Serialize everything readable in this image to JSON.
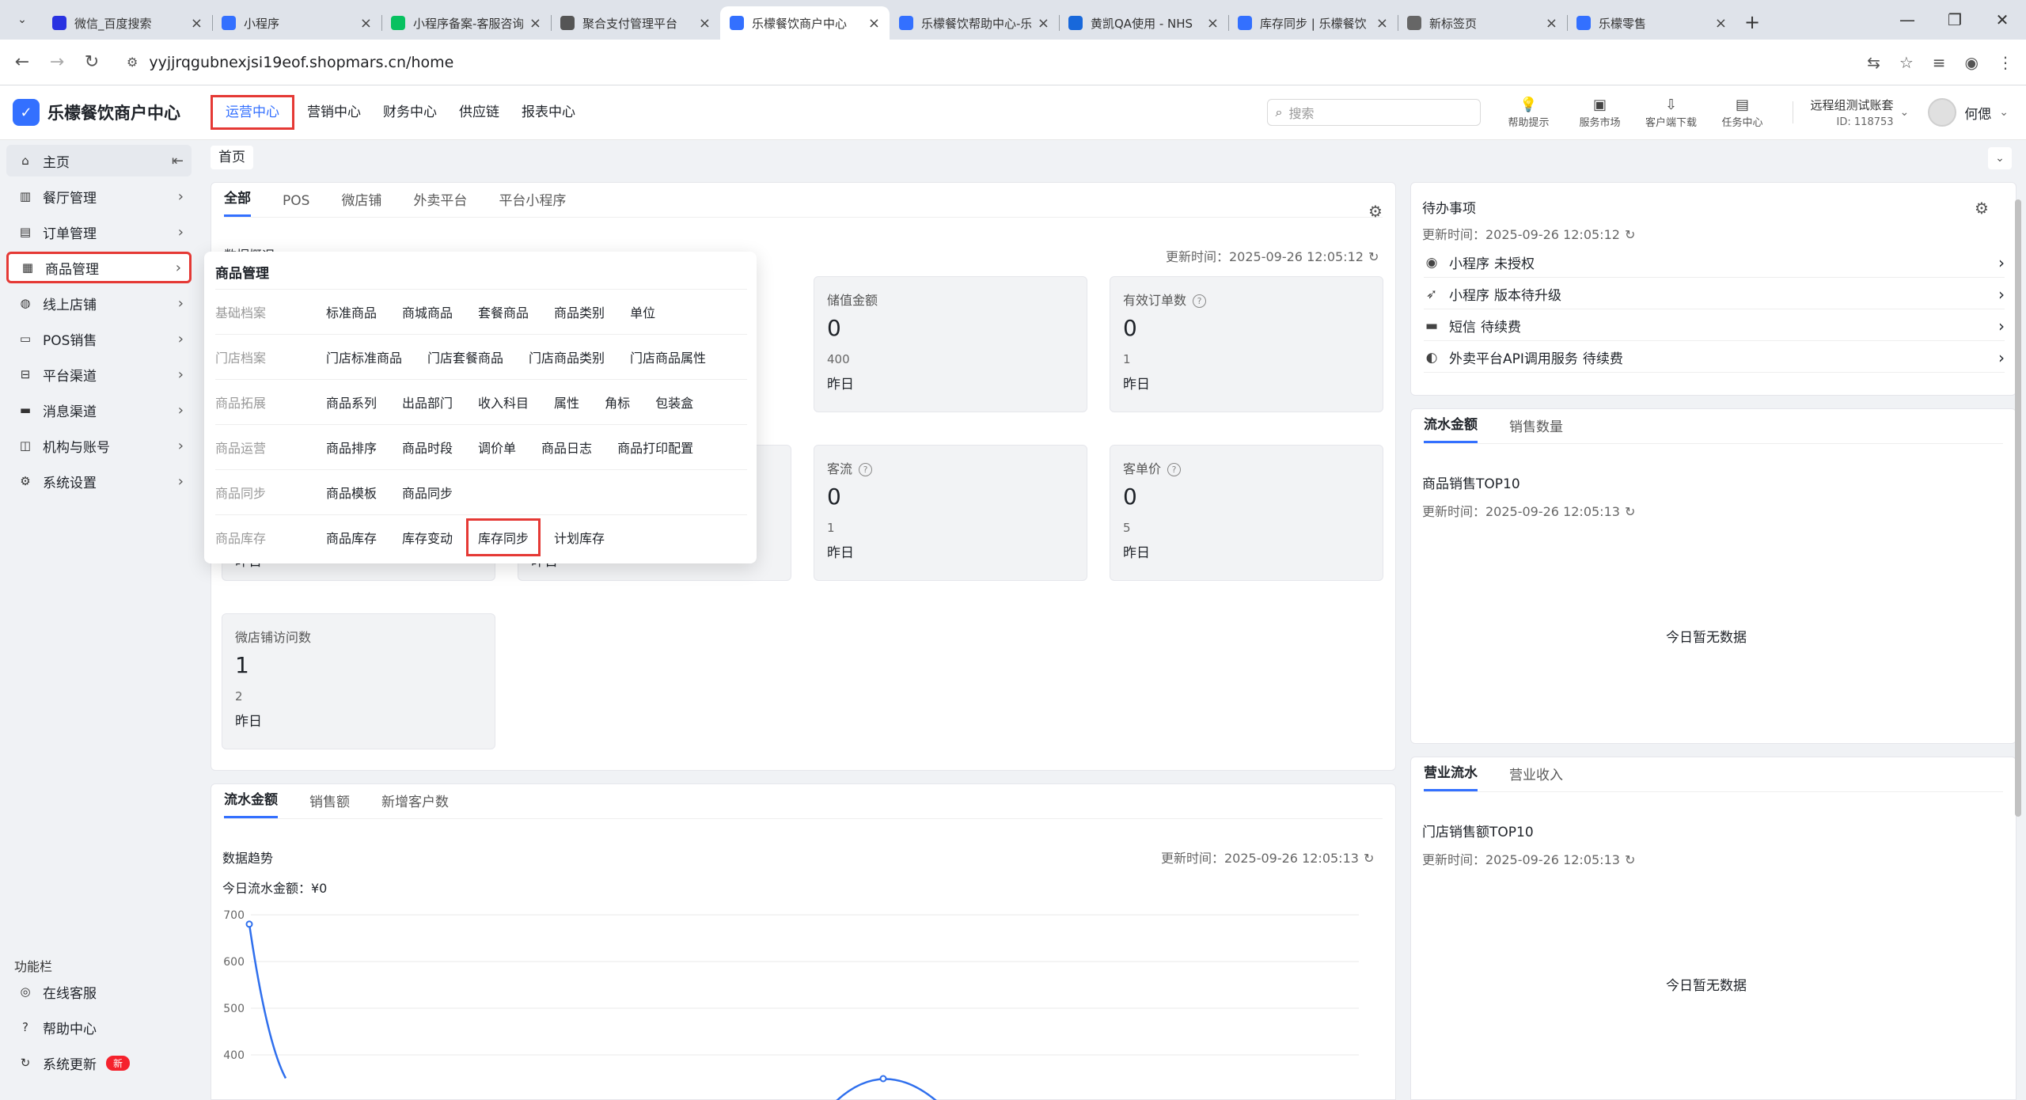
{
  "browser": {
    "tabs": [
      {
        "title": "微信_百度搜索",
        "fav_color": "#2932e1",
        "active": false
      },
      {
        "title": "小程序",
        "fav_color": "#3370ff",
        "active": false
      },
      {
        "title": "小程序备案-客服咨询",
        "fav_color": "#07c160",
        "active": false
      },
      {
        "title": "聚合支付管理平台",
        "fav_color": "#555555",
        "active": false
      },
      {
        "title": "乐檬餐饮商户中心",
        "fav_color": "#3370ff",
        "active": true
      },
      {
        "title": "乐檬餐饮帮助中心-乐",
        "fav_color": "#3370ff",
        "active": false
      },
      {
        "title": "黄凯QA使用 - NHS",
        "fav_color": "#1868db",
        "active": false
      },
      {
        "title": "库存同步 | 乐檬餐饮",
        "fav_color": "#3370ff",
        "active": false
      },
      {
        "title": "新标签页",
        "fav_color": "#666666",
        "active": false
      },
      {
        "title": "乐檬零售",
        "fav_color": "#3370ff",
        "active": false
      }
    ],
    "url": "yyjjrqgubnexjsi19eof.shopmars.cn/home"
  },
  "app": {
    "logo_text": "乐檬餐饮商户中心",
    "nav": [
      "运营中心",
      "营销中心",
      "财务中心",
      "供应链",
      "报表中心"
    ],
    "active_nav": "运营中心",
    "search_placeholder": "搜索",
    "tools": [
      "帮助提示",
      "服务市场",
      "客户端下载",
      "任务中心"
    ],
    "account_name": "远程组测试账套",
    "account_id": "ID: 118753",
    "user_name": "何偲"
  },
  "sidebar": {
    "items": [
      "主页",
      "餐厅管理",
      "订单管理",
      "商品管理",
      "线上店铺",
      "POS销售",
      "平台渠道",
      "消息渠道",
      "机构与账号",
      "系统设置"
    ],
    "func_title": "功能栏",
    "func_items": [
      "在线客服",
      "帮助中心",
      "系统更新"
    ],
    "new_badge": "新"
  },
  "breadcrumb": "首页",
  "overview": {
    "tabs": [
      "全部",
      "POS",
      "微店铺",
      "外卖平台",
      "平台小程序"
    ],
    "section_title": "数据概况",
    "updated": "更新时间：2025-09-26 12:05:12",
    "stats": [
      {
        "label": "储值金额",
        "value": "0",
        "prev": "400",
        "prev_label": "昨日",
        "help": false
      },
      {
        "label": "有效订单数",
        "value": "0",
        "prev": "1",
        "prev_label": "昨日",
        "help": true
      },
      {
        "label": "客流",
        "value": "0",
        "prev": "1",
        "prev_label": "昨日",
        "help": true
      },
      {
        "label": "客单价",
        "value": "0",
        "prev": "5",
        "prev_label": "昨日",
        "help": true
      },
      {
        "label": "微店铺访问数",
        "value": "1",
        "prev": "2",
        "prev_label": "昨日",
        "help": false
      }
    ],
    "hidden_prev_labels": [
      "昨日",
      "昨日"
    ]
  },
  "trend": {
    "tabs": [
      "流水金额",
      "销售额",
      "新增客户数"
    ],
    "title": "数据趋势",
    "updated": "更新时间：2025-09-26 12:05:13",
    "today_label": "今日流水金额：¥0"
  },
  "chart_data": {
    "type": "line",
    "title": "数据趋势",
    "ylim": [
      400,
      700
    ],
    "yticks": [
      700,
      600,
      500,
      400
    ],
    "grid": true,
    "series": [
      {
        "values": [
          680,
          350
        ]
      }
    ],
    "note_visible_partial": true
  },
  "todo": {
    "title": "待办事项",
    "updated": "更新时间：2025-09-26 12:05:12",
    "items": [
      {
        "name": "小程序",
        "status": "未授权",
        "icon": "miniapp-icon"
      },
      {
        "name": "小程序",
        "status": "版本待升级",
        "icon": "rocket-icon"
      },
      {
        "name": "短信",
        "status": "待续费",
        "icon": "sms-icon"
      },
      {
        "name": "外卖平台API调用服务",
        "status": "待续费",
        "icon": "api-icon"
      }
    ]
  },
  "top10": {
    "tabs": [
      "流水金额",
      "销售数量"
    ],
    "title": "商品销售TOP10",
    "updated": "更新时间：2025-09-26 12:05:13",
    "empty": "今日暂无数据"
  },
  "store_top10": {
    "tabs": [
      "营业流水",
      "营业收入"
    ],
    "title": "门店销售额TOP10",
    "updated": "更新时间：2025-09-26 12:05:13",
    "empty": "今日暂无数据"
  },
  "menu": {
    "title": "商品管理",
    "groups": [
      {
        "category": "基础档案",
        "links": [
          "标准商品",
          "商城商品",
          "套餐商品",
          "商品类别",
          "单位"
        ]
      },
      {
        "category": "门店档案",
        "links": [
          "门店标准商品",
          "门店套餐商品",
          "门店商品类别",
          "门店商品属性"
        ]
      },
      {
        "category": "商品拓展",
        "links": [
          "商品系列",
          "出品部门",
          "收入科目",
          "属性",
          "角标",
          "包装盒"
        ]
      },
      {
        "category": "商品运营",
        "links": [
          "商品排序",
          "商品时段",
          "调价单",
          "商品日志",
          "商品打印配置"
        ]
      },
      {
        "category": "商品同步",
        "links": [
          "商品模板",
          "商品同步"
        ]
      },
      {
        "category": "商品库存",
        "links": [
          "商品库存",
          "库存变动",
          "库存同步",
          "计划库存"
        ]
      }
    ],
    "highlighted": "库存同步"
  },
  "colors": {
    "accent": "#3370ff",
    "highlight_box": "#e53935",
    "chart_line": "#2f6fed"
  }
}
